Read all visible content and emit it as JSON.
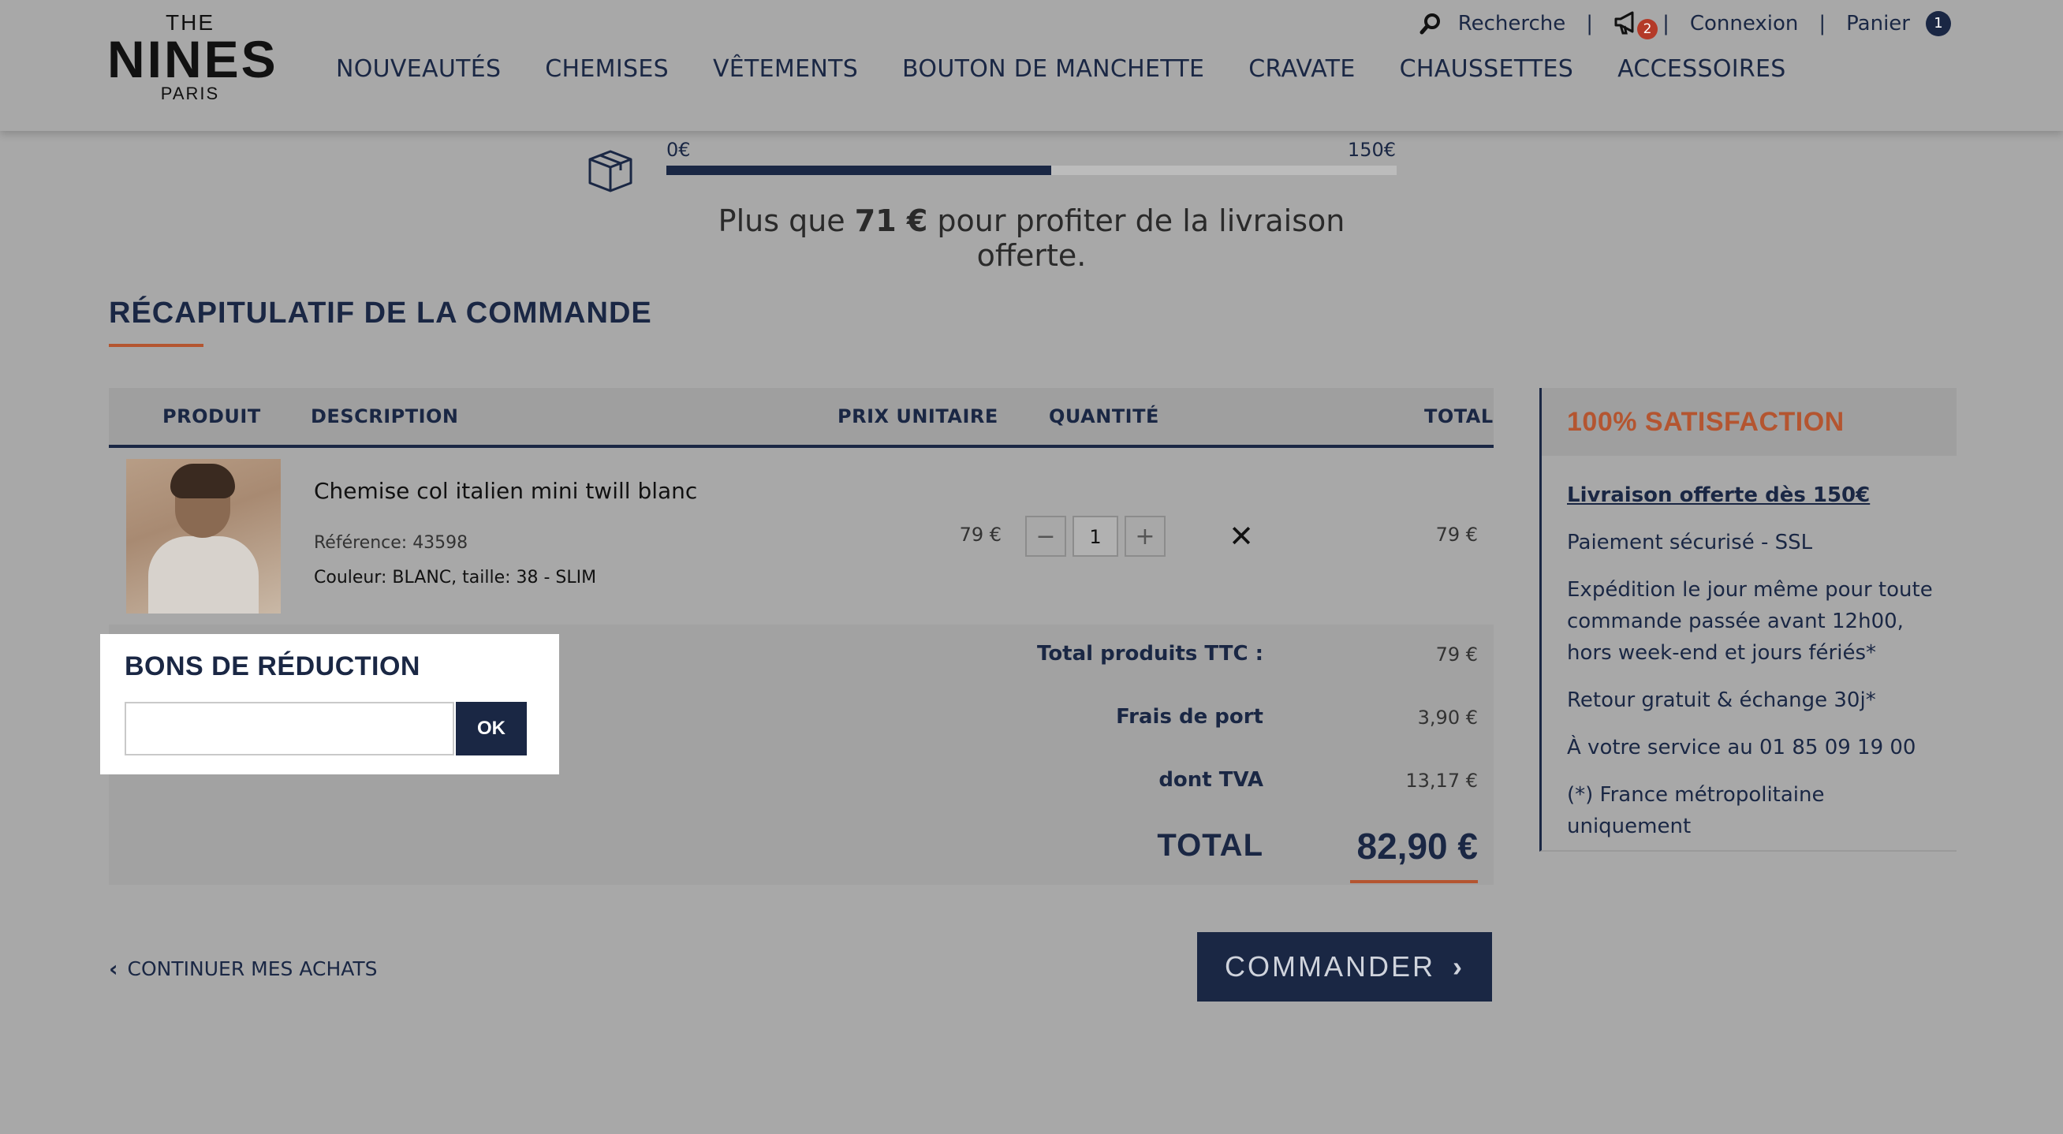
{
  "header": {
    "logo": {
      "top": "THE",
      "main": "NINES",
      "bottom": "PARIS"
    },
    "nav": [
      "NOUVEAUTÉS",
      "CHEMISES",
      "VÊTEMENTS",
      "BOUTON DE MANCHETTE",
      "CRAVATE",
      "CHAUSSETTES",
      "ACCESSOIRES"
    ],
    "topbar": {
      "search_label": "Recherche",
      "separator": "|",
      "notifications_count": "2",
      "login_label": "Connexion",
      "cart_label": "Panier",
      "cart_count": "1"
    }
  },
  "shipping": {
    "min_label": "0€",
    "max_label": "150€",
    "progress_fraction": 0.527,
    "message_prefix": "Plus que ",
    "message_amount": "71 €",
    "message_suffix": " pour profiter de la livraison offerte."
  },
  "order": {
    "title": "RÉCAPITULATIF DE LA COMMANDE",
    "columns": {
      "product": "PRODUIT",
      "description": "DESCRIPTION",
      "unit_price": "PRIX UNITAIRE",
      "quantity": "QUANTITÉ",
      "total": "TOTAL"
    },
    "item": {
      "name": "Chemise col italien mini twill blanc",
      "reference": "Référence: 43598",
      "color_size": "Couleur: BLANC, taille: 38 - SLIM",
      "unit_price": "79 €",
      "quantity": "1",
      "minus": "−",
      "plus": "+",
      "remove": "✕",
      "total": "79 €"
    },
    "totals": {
      "products_label": "Total produits TTC :",
      "products_value": "79 €",
      "shipping_label": "Frais de port",
      "shipping_value": "3,90 €",
      "vat_label": "dont TVA",
      "vat_value": "13,17 €",
      "grand_label": "TOTAL",
      "grand_value": "82,90 €"
    }
  },
  "coupon": {
    "title": "BONS DE RÉDUCTION",
    "input_value": "",
    "button": "OK"
  },
  "actions": {
    "continue": "CONTINUER MES ACHATS",
    "checkout": "COMMANDER"
  },
  "satisfaction": {
    "title": "100% SATISFACTION",
    "free_shipping": "Livraison offerte dès 150€",
    "secure": "Paiement sécurisé - SSL",
    "dispatch": "Expédition le jour même pour toute commande passée avant 12h00, hors week-end et jours fériés*",
    "returns": "Retour gratuit & échange 30j*",
    "service": "À votre service au 01 85 09 19 00",
    "note": "(*) France métropolitaine uniquement"
  }
}
